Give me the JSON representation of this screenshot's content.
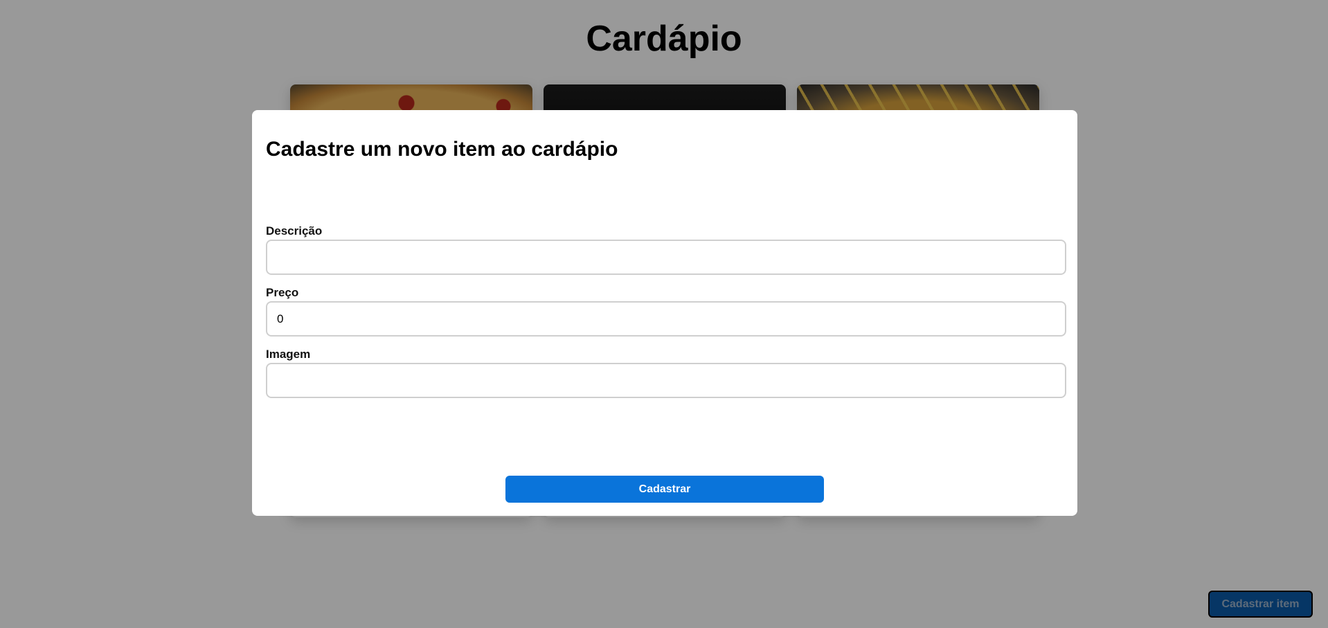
{
  "page": {
    "title": "Cardápio"
  },
  "cards": [
    {
      "image": "pizza-photo"
    },
    {
      "image": "dark-photo"
    },
    {
      "image": "fries-photo"
    }
  ],
  "modal": {
    "title": "Cadastre um novo item ao cardápio",
    "fields": {
      "descricao": {
        "label": "Descrição",
        "value": ""
      },
      "preco": {
        "label": "Preço",
        "value": "0"
      },
      "imagem": {
        "label": "Imagem",
        "value": ""
      }
    },
    "submit_label": "Cadastrar"
  },
  "fab": {
    "label": "Cadastrar item"
  },
  "colors": {
    "primary": "#0a74da",
    "overlay": "rgba(0,0,0,0.4)"
  }
}
